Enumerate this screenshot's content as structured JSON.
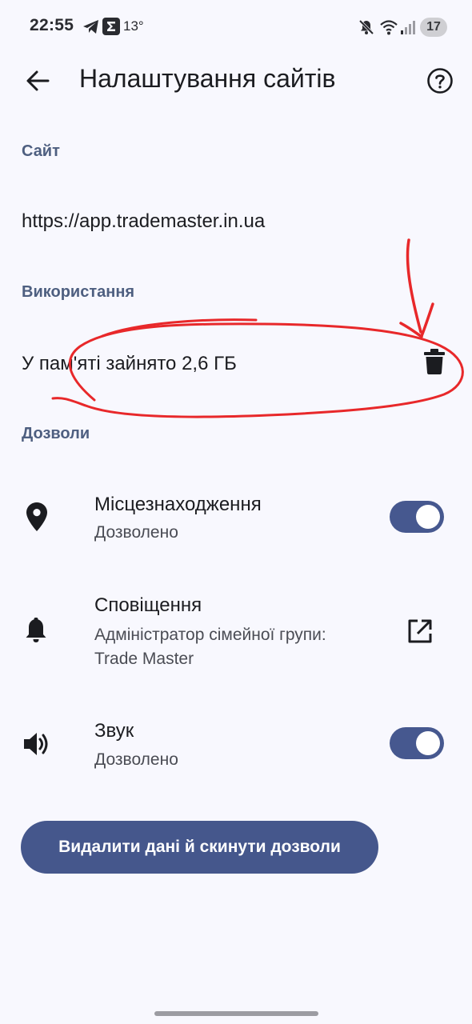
{
  "status_bar": {
    "time": "22:55",
    "temperature": "13°",
    "battery": "17",
    "icons": [
      "telegram-icon",
      "sigma-app-icon",
      "mute-icon",
      "wifi-icon",
      "signal-icon",
      "battery-icon"
    ]
  },
  "app_bar": {
    "title": "Налаштування сайтів",
    "back_icon": "arrow-back-icon",
    "help_icon": "help-icon"
  },
  "site_section": {
    "header": "Сайт",
    "url": "https://app.trademaster.in.ua"
  },
  "usage_section": {
    "header": "Використання",
    "storage_text": "У пам'яті зайнято 2,6 ГБ",
    "delete_icon": "trash-icon"
  },
  "permissions_section": {
    "header": "Дозволи",
    "items": [
      {
        "icon": "location-pin-icon",
        "title": "Місцезнаходження",
        "subtitle": "Дозволено",
        "control": "toggle",
        "enabled": true
      },
      {
        "icon": "bell-icon",
        "title": "Сповіщення",
        "subtitle": "Адміністратор сімейної групи: Trade Master",
        "control": "open-external-icon"
      },
      {
        "icon": "speaker-icon",
        "title": "Звук",
        "subtitle": "Дозволено",
        "control": "toggle",
        "enabled": true
      }
    ]
  },
  "reset_button": {
    "label": "Видалити дані й скинути дозволи"
  },
  "colors": {
    "background": "#f8f8fe",
    "section_header": "#4e5f80",
    "accent": "#45578c",
    "annotation": "#e8282a"
  }
}
